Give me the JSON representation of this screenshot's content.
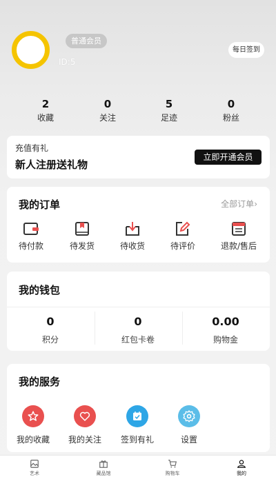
{
  "profile": {
    "member_badge": "普通会员",
    "user_id": "ID:5",
    "signin_label": "每日签到",
    "avatar_color": "#f5c400"
  },
  "stats": [
    {
      "value": "2",
      "label": "收藏"
    },
    {
      "value": "0",
      "label": "关注"
    },
    {
      "value": "5",
      "label": "足迹"
    },
    {
      "value": "0",
      "label": "粉丝"
    }
  ],
  "promo": {
    "small_text": "充值有礼",
    "headline": "新人注册送礼物",
    "button_label": "立即开通会员"
  },
  "orders": {
    "title": "我的订单",
    "all_label": "全部订单",
    "items": [
      {
        "label": "待付款",
        "icon": "wallet-icon"
      },
      {
        "label": "待发货",
        "icon": "package-icon"
      },
      {
        "label": "待收货",
        "icon": "inbox-download-icon"
      },
      {
        "label": "待评价",
        "icon": "edit-review-icon"
      },
      {
        "label": "退款/售后",
        "icon": "refund-list-icon"
      }
    ]
  },
  "wallet": {
    "title": "我的钱包",
    "items": [
      {
        "value": "0",
        "label": "积分"
      },
      {
        "value": "0",
        "label": "红包卡卷"
      },
      {
        "value": "0.00",
        "label": "购物金"
      }
    ]
  },
  "services": {
    "title": "我的服务",
    "items": [
      {
        "label": "我的收藏",
        "icon": "star-icon",
        "color": "#e9504f"
      },
      {
        "label": "我的关注",
        "icon": "heart-icon",
        "color": "#e9504f"
      },
      {
        "label": "签到有礼",
        "icon": "calendar-check-icon",
        "color": "#2ea6e6"
      },
      {
        "label": "设置",
        "icon": "gear-icon",
        "color": "#5bbde8"
      }
    ]
  },
  "tabbar": [
    {
      "label": "艺术",
      "icon": "image-icon"
    },
    {
      "label": "藏品馆",
      "icon": "gift-box-icon"
    },
    {
      "label": "购物车",
      "icon": "cart-icon"
    },
    {
      "label": "我的",
      "icon": "user-icon",
      "active": true
    }
  ]
}
